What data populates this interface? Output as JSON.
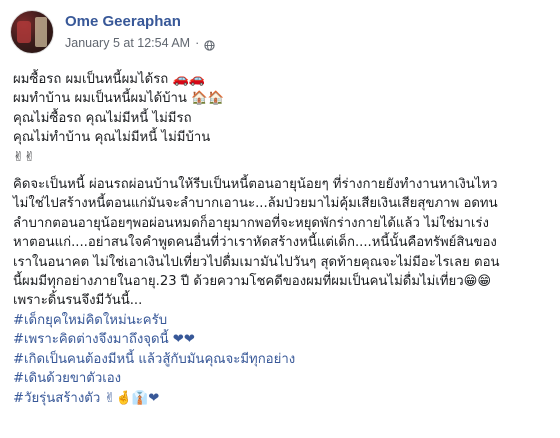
{
  "post": {
    "author": "Ome Geeraphan",
    "timestamp": "January 5 at 12:54 AM",
    "separator": "·",
    "privacy_icon": "globe-icon",
    "paragraph1": [
      "ผมซื้อรถ ผมเป็นหนี้ผมได้รถ 🚗🚗",
      "ผมทำบ้าน ผมเป็นหนี้ผมได้บ้าน 🏠🏠",
      "คุณไม่ซื้อรถ คุณไม่มีหนี้ ไม่มีรถ",
      "คุณไม่ทำบ้าน คุณไม่มีหนี้ ไม่มีบ้าน",
      "✌✌"
    ],
    "paragraph2": [
      "คิดจะเป็นหนี้ ผ่อนรถผ่อนบ้านให้รีบเป็นหนี้ตอนอายุน้อยๆ ที่ร่างกายยังทำงานหาเงินไหว",
      "ไม่ใช่ไปสร้างหนี้ตอนแก่มันจะลำบากเอานะ...ล้มป่วยมาไม่คุ้มเสียเงินเสียสุขภาพ อดทน",
      "ลำบากตอนอายุน้อยๆพอผ่อนหมดก็อายุมากพอที่จะหยุดพักร่างกายได้แล้ว ไม่ใช่มาเร่ง",
      "หาตอนแก่....อย่าสนใจคำพูดคนอื่นที่ว่าเราหัดสร้างหนี้แต่เด็ก....หนี้นั้นคือทรัพย์สินของ",
      "เราในอนาคต ไม่ใช่เอาเงินไปเที่ยวไปดื่มเมามันไปวันๆ สุดท้ายคุณจะไม่มีอะไรเลย ตอน",
      "นี้ผมมีทุกอย่างภายในอายุ.23 ปี ด้วยความโชคดีของผมที่ผมเป็นคนไม่ดื่มไม่เที่ยว😁😁",
      "เพราะดิ้นรนจึงมีวันนี้..."
    ],
    "hashtags": [
      "#เด็กยุคใหม่คิดใหม่นะครับ",
      "#เพราะคิดต่างจึงมาถึงจุดนี้ ❤❤",
      "#เกิดเป็นคนต้องมีหนี้ แล้วสู้กับมันคุณจะมีทุกอย่าง",
      "#เดินด้วยขาตัวเอง",
      "#วัยรุ่นสร้างตัว ✌🤞👔❤"
    ]
  },
  "colors": {
    "link": "#385898",
    "text": "#1c1e21",
    "muted": "#616770"
  }
}
